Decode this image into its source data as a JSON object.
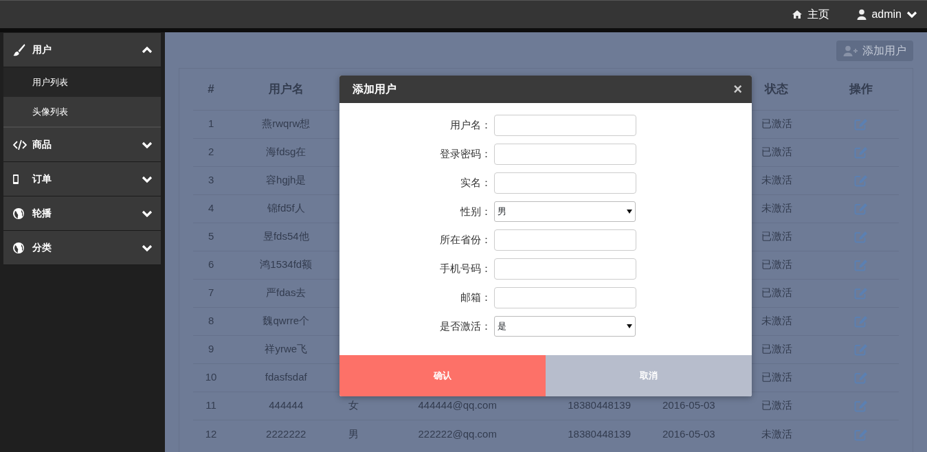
{
  "topbar": {
    "home": "主页",
    "user": "admin"
  },
  "sidebar": {
    "items": [
      {
        "label": "用户",
        "expanded": true,
        "children": [
          {
            "label": "用户列表",
            "selected": true
          },
          {
            "label": "头像列表",
            "selected": false
          }
        ]
      },
      {
        "label": "商品",
        "expanded": false
      },
      {
        "label": "订单",
        "expanded": false
      },
      {
        "label": "轮播",
        "expanded": false
      },
      {
        "label": "分类",
        "expanded": false
      }
    ]
  },
  "add_button": "添加用户",
  "table": {
    "columns": [
      "#",
      "用户名",
      null,
      null,
      null,
      null,
      "状态",
      "操作"
    ],
    "rows": [
      {
        "cells": [
          "1",
          "燕rwqrw想",
          null,
          null,
          null,
          null,
          "已激活"
        ]
      },
      {
        "cells": [
          "2",
          "海fdsg在",
          null,
          null,
          null,
          null,
          "已激活"
        ]
      },
      {
        "cells": [
          "3",
          "容hgjh是",
          null,
          null,
          null,
          null,
          "未激活"
        ]
      },
      {
        "cells": [
          "4",
          "锦fd5f人",
          null,
          null,
          null,
          null,
          "未激活"
        ]
      },
      {
        "cells": [
          "5",
          "昱fds54他",
          null,
          null,
          null,
          null,
          "已激活"
        ]
      },
      {
        "cells": [
          "6",
          "鸿1534fd额",
          null,
          null,
          null,
          null,
          "已激活"
        ]
      },
      {
        "cells": [
          "7",
          "严fdas去",
          null,
          null,
          null,
          null,
          "已激活"
        ]
      },
      {
        "cells": [
          "8",
          "魏qwrre个",
          null,
          null,
          null,
          null,
          "未激活"
        ]
      },
      {
        "cells": [
          "9",
          "祥yrwe飞",
          null,
          null,
          null,
          null,
          "已激活"
        ]
      },
      {
        "cells": [
          "10",
          "fdasfsdaf",
          null,
          null,
          null,
          null,
          "已激活"
        ]
      },
      {
        "cells": [
          "11",
          "444444",
          "女",
          "444444@qq.com",
          "18380448139",
          "2016-05-03",
          "已激活"
        ]
      },
      {
        "cells": [
          "12",
          "2222222",
          "男",
          "222222@qq.com",
          "18380448139",
          "2016-05-03",
          "未激活"
        ]
      }
    ]
  },
  "modal": {
    "title": "添加用户",
    "close": "×",
    "fields": [
      {
        "label": "用户名：",
        "kind": "text"
      },
      {
        "label": "登录密码：",
        "kind": "text"
      },
      {
        "label": "实名：",
        "kind": "text"
      },
      {
        "label": "性别：",
        "kind": "select",
        "value": "男"
      },
      {
        "label": "所在省份：",
        "kind": "text"
      },
      {
        "label": "手机号码：",
        "kind": "text"
      },
      {
        "label": "邮箱：",
        "kind": "text"
      },
      {
        "label": "是否激活：",
        "kind": "select",
        "value": "是"
      }
    ],
    "confirm": "确认",
    "cancel": "取消"
  }
}
